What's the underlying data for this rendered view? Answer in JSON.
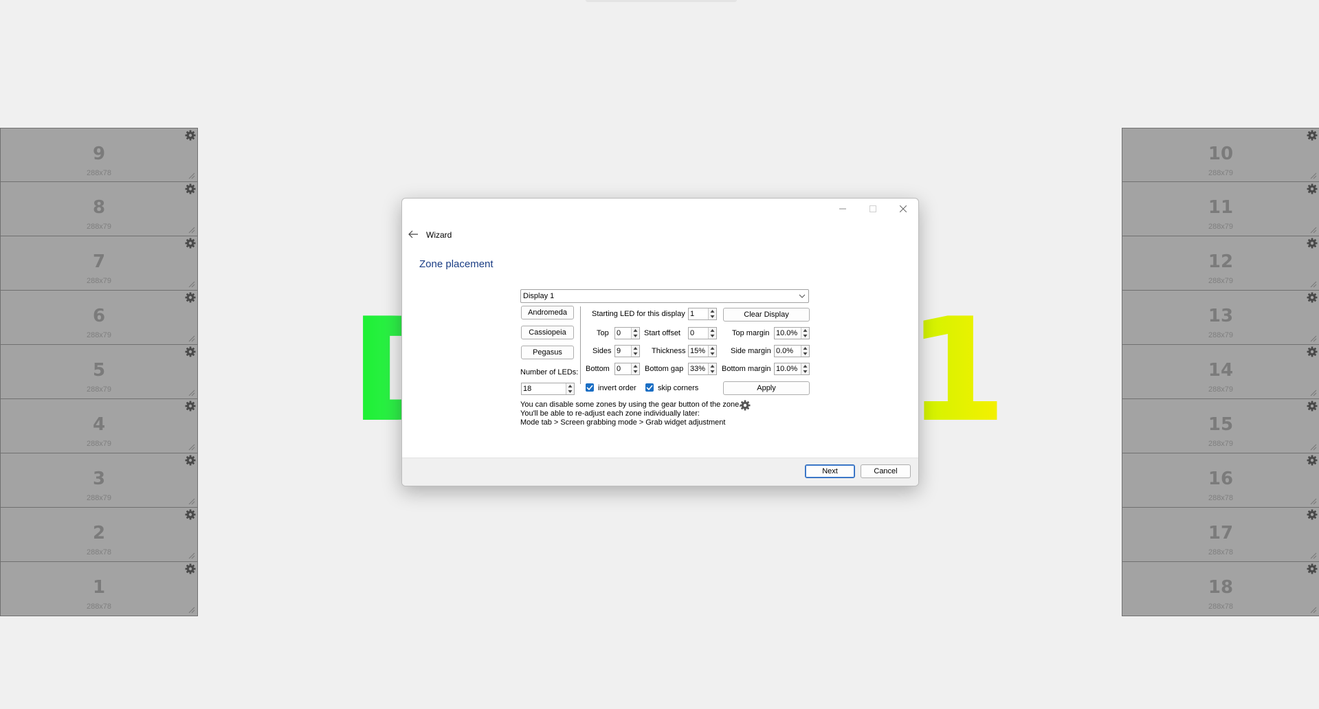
{
  "background": {
    "display_label_left": "D",
    "display_label_right": "1"
  },
  "zones_left": [
    {
      "number": "9",
      "size": "288x78"
    },
    {
      "number": "8",
      "size": "288x79"
    },
    {
      "number": "7",
      "size": "288x79"
    },
    {
      "number": "6",
      "size": "288x79"
    },
    {
      "number": "5",
      "size": "288x79"
    },
    {
      "number": "4",
      "size": "288x79"
    },
    {
      "number": "3",
      "size": "288x79"
    },
    {
      "number": "2",
      "size": "288x78"
    },
    {
      "number": "1",
      "size": "288x78"
    }
  ],
  "zones_right": [
    {
      "number": "10",
      "size": "288x79"
    },
    {
      "number": "11",
      "size": "288x79"
    },
    {
      "number": "12",
      "size": "288x79"
    },
    {
      "number": "13",
      "size": "288x79"
    },
    {
      "number": "14",
      "size": "288x79"
    },
    {
      "number": "15",
      "size": "288x79"
    },
    {
      "number": "16",
      "size": "288x78"
    },
    {
      "number": "17",
      "size": "288x78"
    },
    {
      "number": "18",
      "size": "288x78"
    }
  ],
  "dialog": {
    "title": "Wizard",
    "heading": "Zone placement",
    "display_select": "Display 1",
    "presets": [
      "Andromeda",
      "Cassiopeia",
      "Pegasus"
    ],
    "num_leds_label": "Number of LEDs:",
    "num_leds_value": "18",
    "starting_led_label": "Starting LED for this display",
    "starting_led_value": "1",
    "clear_display": "Clear Display",
    "top_label": "Top",
    "top_value": "0",
    "sides_label": "Sides",
    "sides_value": "9",
    "bottom_label": "Bottom",
    "bottom_value": "0",
    "start_offset_label": "Start offset",
    "start_offset_value": "0",
    "thickness_label": "Thickness",
    "thickness_value": "15%",
    "bottom_gap_label": "Bottom gap",
    "bottom_gap_value": "33%",
    "top_margin_label": "Top margin",
    "top_margin_value": "10.0%",
    "side_margin_label": "Side margin",
    "side_margin_value": "0.0%",
    "bottom_margin_label": "Bottom margin",
    "bottom_margin_value": "10.0%",
    "invert_order_label": "invert order",
    "invert_order_checked": true,
    "skip_corners_label": "skip corners",
    "skip_corners_checked": true,
    "apply": "Apply",
    "info_line1": "You can disable some zones by using the gear button of the zone.",
    "info_line2": "You'll be able to re-adjust each zone individually later:",
    "info_line3": "Mode tab > Screen grabbing mode > Grab widget adjustment",
    "next": "Next",
    "cancel": "Cancel"
  },
  "colors": {
    "zone_fill": "#a3a3a3",
    "accent": "#1a6ec4",
    "heading": "#1a3d84",
    "label_left": "#22f045",
    "label_right": "#e6f000"
  }
}
